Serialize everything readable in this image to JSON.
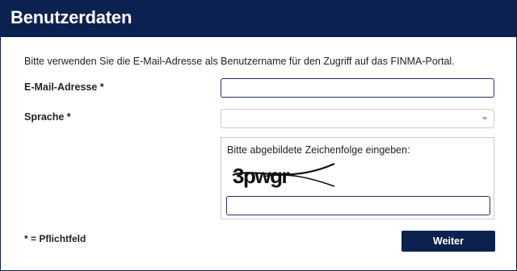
{
  "header": {
    "title": "Benutzerdaten"
  },
  "form": {
    "intro": "Bitte verwenden Sie die E-Mail-Adresse als Benutzername für den Zugriff auf das FINMA-Portal.",
    "email_label": "E-Mail-Adresse *",
    "email_value": "",
    "language_label": "Sprache *",
    "language_selected": "",
    "captcha_label": "Bitte abgebildete Zeichenfolge eingeben:",
    "captcha_text": "3pwgr",
    "captcha_value": "",
    "required_note": "*  = Pflichtfeld",
    "next_button": "Weiter"
  },
  "colors": {
    "brand_navy": "#0b2150",
    "input_border": "#1f3566",
    "muted_border": "#c8ccd4"
  },
  "icons": {
    "select_arrow": "chevron-down-icon"
  }
}
